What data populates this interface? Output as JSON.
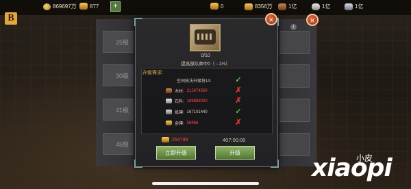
{
  "topbar": {
    "coins": "869697万",
    "gold": "877",
    "food": "0",
    "wood": "8356万",
    "stone": "1亿",
    "stone2": "1亿",
    "iron": "1亿"
  },
  "left_list": [
    "25级",
    "30级",
    "41级",
    "45级"
  ],
  "dialog": {
    "progress": "0/10",
    "effect": "提高部队命中0（→1%）",
    "requirements_title": "升级需求:",
    "requirements": [
      {
        "label": "空间技法升级符1/1",
        "value": "",
        "met": true
      },
      {
        "label": "木材:",
        "value": "212674560",
        "met": false
      },
      {
        "label": "石料:",
        "value": "189888000",
        "met": false
      },
      {
        "label": "纸磚:",
        "value": "167101440",
        "met": true
      },
      {
        "label": "金磚:",
        "value": "56966",
        "met": false
      }
    ],
    "cost": "254796",
    "time": "407:00:00",
    "instant_button": "立即升级",
    "upgrade_button": "升级"
  },
  "logo": {
    "text": "xiaopi",
    "sub": "小皮"
  },
  "colors": {
    "accent_gold": "#e0b64c",
    "ok_green": "#52c63b",
    "fail_red": "#e23a2a",
    "red_value": "#ff4a3a"
  }
}
